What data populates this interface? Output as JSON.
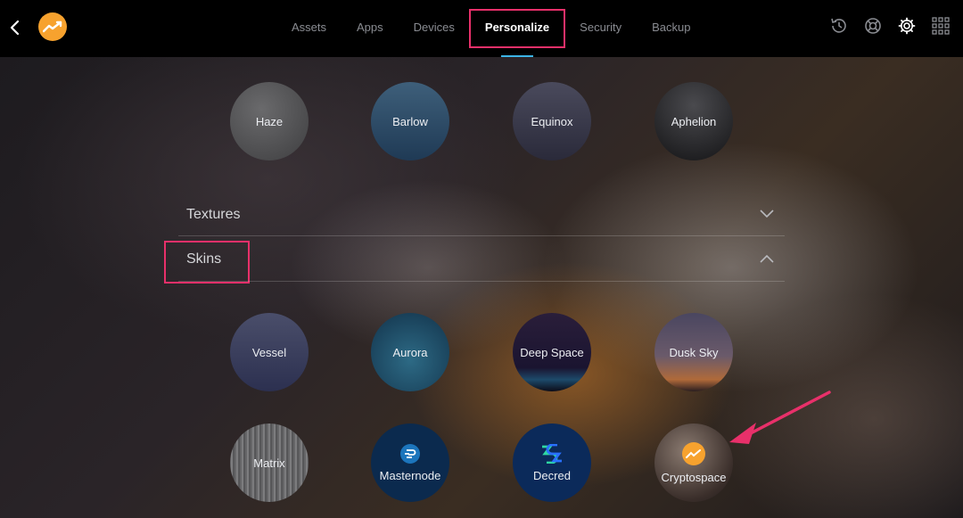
{
  "topbar": {
    "tabs": [
      "Assets",
      "Apps",
      "Devices",
      "Personalize",
      "Security",
      "Backup"
    ],
    "active_tab": "Personalize"
  },
  "themes": [
    "Haze",
    "Barlow",
    "Equinox",
    "Aphelion"
  ],
  "sections": {
    "textures": "Textures",
    "skins": "Skins"
  },
  "skins_row1": [
    "Vessel",
    "Aurora",
    "Deep Space",
    "Dusk Sky"
  ],
  "skins_row2": [
    "Matrix",
    "Masternode",
    "Decred",
    "Cryptospace"
  ],
  "colors": {
    "accent_highlight": "#e8306a",
    "active_underline": "#3cb4e6",
    "logo": "#f7a22e"
  }
}
